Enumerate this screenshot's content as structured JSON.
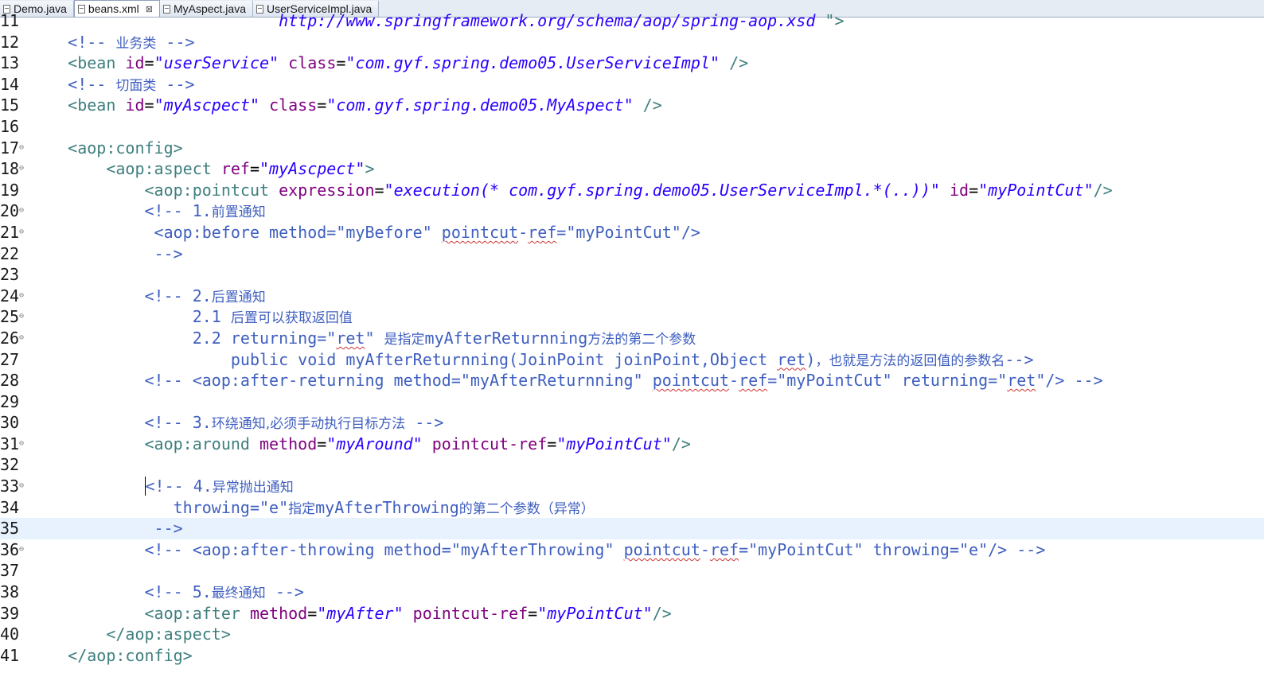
{
  "tabs": [
    {
      "label": "Demo.java",
      "icon": "java-file-icon",
      "active": false
    },
    {
      "label": "beans.xml",
      "icon": "xml-file-icon",
      "active": true
    },
    {
      "label": "MyAspect.java",
      "icon": "java-file-icon",
      "active": false
    },
    {
      "label": "UserServiceImpl.java",
      "icon": "java-file-icon",
      "active": false
    }
  ],
  "current_line": 35,
  "lines": [
    {
      "n": "11",
      "fold": false,
      "segs": [
        [
          "v",
          "http://www.springframework.org/schema/aop/spring-aop.xsd"
        ],
        [
          "t",
          " \">"
        ]
      ],
      "indent": "                          "
    },
    {
      "n": "12",
      "fold": false,
      "segs": [
        [
          "c",
          "<!-- "
        ],
        [
          "cj",
          "业务类"
        ],
        [
          "c",
          " -->"
        ]
      ],
      "indent": "    "
    },
    {
      "n": "13",
      "fold": false,
      "segs": [
        [
          "t",
          "<bean "
        ],
        [
          "a",
          "id"
        ],
        [
          "p",
          "="
        ],
        [
          "v",
          "\"userService\""
        ],
        [
          "p",
          " "
        ],
        [
          "a",
          "class"
        ],
        [
          "p",
          "="
        ],
        [
          "v",
          "\"com.gyf.spring.demo05.UserServiceImpl\""
        ],
        [
          "t",
          " />"
        ]
      ],
      "indent": "    "
    },
    {
      "n": "14",
      "fold": false,
      "segs": [
        [
          "c",
          "<!-- "
        ],
        [
          "cj",
          "切面类"
        ],
        [
          "c",
          " -->"
        ]
      ],
      "indent": "    "
    },
    {
      "n": "15",
      "fold": false,
      "segs": [
        [
          "t",
          "<bean "
        ],
        [
          "a",
          "id"
        ],
        [
          "p",
          "="
        ],
        [
          "v",
          "\"myAscpect\""
        ],
        [
          "p",
          " "
        ],
        [
          "a",
          "class"
        ],
        [
          "p",
          "="
        ],
        [
          "v",
          "\"com.gyf.spring.demo05.MyAspect\""
        ],
        [
          "t",
          " />"
        ]
      ],
      "indent": "    "
    },
    {
      "n": "16",
      "fold": false,
      "segs": [],
      "indent": ""
    },
    {
      "n": "17",
      "fold": true,
      "segs": [
        [
          "t",
          "<aop:config>"
        ]
      ],
      "indent": "    "
    },
    {
      "n": "18",
      "fold": true,
      "segs": [
        [
          "t",
          "<aop:aspect "
        ],
        [
          "a",
          "ref"
        ],
        [
          "p",
          "="
        ],
        [
          "v",
          "\"myAscpect\""
        ],
        [
          "t",
          ">"
        ]
      ],
      "indent": "        "
    },
    {
      "n": "19",
      "fold": false,
      "segs": [
        [
          "t",
          "<aop:pointcut "
        ],
        [
          "a",
          "expression"
        ],
        [
          "p",
          "="
        ],
        [
          "v",
          "\"execution(* com.gyf.spring.demo05.UserServiceImpl.*(..))\""
        ],
        [
          "p",
          " "
        ],
        [
          "a",
          "id"
        ],
        [
          "p",
          "="
        ],
        [
          "v",
          "\"myPointCut\""
        ],
        [
          "t",
          "/>"
        ]
      ],
      "indent": "            "
    },
    {
      "n": "20",
      "fold": true,
      "segs": [
        [
          "c",
          "<!-- 1."
        ],
        [
          "cj",
          "前置通知"
        ]
      ],
      "indent": "            "
    },
    {
      "n": "21",
      "fold": true,
      "segs": [
        [
          "c",
          " <aop:before method=\"myBefore\" "
        ],
        [
          "cu",
          "pointcut"
        ],
        [
          "c",
          "-"
        ],
        [
          "cu",
          "ref"
        ],
        [
          "c",
          "=\"myPointCut\"/>"
        ]
      ],
      "indent": "            "
    },
    {
      "n": "22",
      "fold": false,
      "segs": [
        [
          "c",
          " -->"
        ]
      ],
      "indent": "            "
    },
    {
      "n": "23",
      "fold": false,
      "segs": [],
      "indent": ""
    },
    {
      "n": "24",
      "fold": true,
      "segs": [
        [
          "c",
          "<!-- 2."
        ],
        [
          "cj",
          "后置通知"
        ]
      ],
      "indent": "            "
    },
    {
      "n": "25",
      "fold": true,
      "segs": [
        [
          "c",
          "     2.1 "
        ],
        [
          "cj",
          "后置可以获取返回值"
        ]
      ],
      "indent": "            "
    },
    {
      "n": "26",
      "fold": true,
      "segs": [
        [
          "c",
          "     2.2 returning=\""
        ],
        [
          "cu",
          "ret"
        ],
        [
          "c",
          "\" "
        ],
        [
          "cj",
          "是指定"
        ],
        [
          "c",
          "myAfterReturnning"
        ],
        [
          "cj",
          "方法的第二个参数"
        ]
      ],
      "indent": "            "
    },
    {
      "n": "27",
      "fold": false,
      "segs": [
        [
          "c",
          "         public void myAfterReturnning(JoinPoint joinPoint,Object "
        ],
        [
          "cu",
          "ret"
        ],
        [
          "c",
          ")"
        ],
        [
          "cj",
          "，也就是方法的返回值的参数名"
        ],
        [
          "c",
          "-->"
        ]
      ],
      "indent": "            "
    },
    {
      "n": "28",
      "fold": false,
      "segs": [
        [
          "c",
          "<!-- <aop:after-returning method=\"myAfterReturnning\" "
        ],
        [
          "cu",
          "pointcut"
        ],
        [
          "c",
          "-"
        ],
        [
          "cu",
          "ref"
        ],
        [
          "c",
          "=\"myPointCut\" returning=\""
        ],
        [
          "cu",
          "ret"
        ],
        [
          "c",
          "\"/> -->"
        ]
      ],
      "indent": "            "
    },
    {
      "n": "29",
      "fold": false,
      "segs": [],
      "indent": ""
    },
    {
      "n": "30",
      "fold": false,
      "segs": [
        [
          "c",
          "<!-- 3."
        ],
        [
          "cj",
          "环绕通知,必须手动执行目标方法"
        ],
        [
          "c",
          " -->"
        ]
      ],
      "indent": "            "
    },
    {
      "n": "31",
      "fold": true,
      "segs": [
        [
          "t",
          "<aop:around "
        ],
        [
          "a",
          "method"
        ],
        [
          "p",
          "="
        ],
        [
          "v",
          "\"myAround\""
        ],
        [
          "p",
          " "
        ],
        [
          "a",
          "pointcut-ref"
        ],
        [
          "p",
          "="
        ],
        [
          "v",
          "\"myPointCut\""
        ],
        [
          "t",
          "/>"
        ]
      ],
      "indent": "            "
    },
    {
      "n": "32",
      "fold": false,
      "segs": [],
      "indent": ""
    },
    {
      "n": "33",
      "fold": true,
      "segs": [
        [
          "ck",
          "<"
        ],
        [
          "c",
          "!-- 4."
        ],
        [
          "cj",
          "异常抛出通知"
        ]
      ],
      "indent": "            "
    },
    {
      "n": "34",
      "fold": false,
      "segs": [
        [
          "c",
          "   throwing=\"e\""
        ],
        [
          "cj",
          "指定"
        ],
        [
          "c",
          "myAfterThrowing"
        ],
        [
          "cj",
          "的第二个参数（异常）"
        ]
      ],
      "indent": "            "
    },
    {
      "n": "35",
      "fold": false,
      "segs": [
        [
          "c",
          " -->"
        ]
      ],
      "indent": "            "
    },
    {
      "n": "36",
      "fold": true,
      "segs": [
        [
          "c",
          "<!-- <aop:after-throwing method=\"myAfterThrowing\" "
        ],
        [
          "cu",
          "pointcut"
        ],
        [
          "c",
          "-"
        ],
        [
          "cu",
          "ref"
        ],
        [
          "c",
          "=\"myPointCut\" throwing=\"e\"/> -->"
        ]
      ],
      "indent": "            "
    },
    {
      "n": "37",
      "fold": false,
      "segs": [],
      "indent": ""
    },
    {
      "n": "38",
      "fold": false,
      "segs": [
        [
          "c",
          "<!-- 5."
        ],
        [
          "cj",
          "最终通知"
        ],
        [
          "c",
          " -->"
        ]
      ],
      "indent": "            "
    },
    {
      "n": "39",
      "fold": false,
      "segs": [
        [
          "t",
          "<aop:after "
        ],
        [
          "a",
          "method"
        ],
        [
          "p",
          "="
        ],
        [
          "v",
          "\"myAfter\""
        ],
        [
          "p",
          " "
        ],
        [
          "a",
          "pointcut-ref"
        ],
        [
          "p",
          "="
        ],
        [
          "v",
          "\"myPointCut\""
        ],
        [
          "t",
          "/>"
        ]
      ],
      "indent": "            "
    },
    {
      "n": "40",
      "fold": false,
      "segs": [
        [
          "t",
          "</aop:aspect>"
        ]
      ],
      "indent": "        "
    },
    {
      "n": "41",
      "fold": false,
      "segs": [
        [
          "t",
          "</aop:config>"
        ]
      ],
      "indent": "    "
    }
  ]
}
